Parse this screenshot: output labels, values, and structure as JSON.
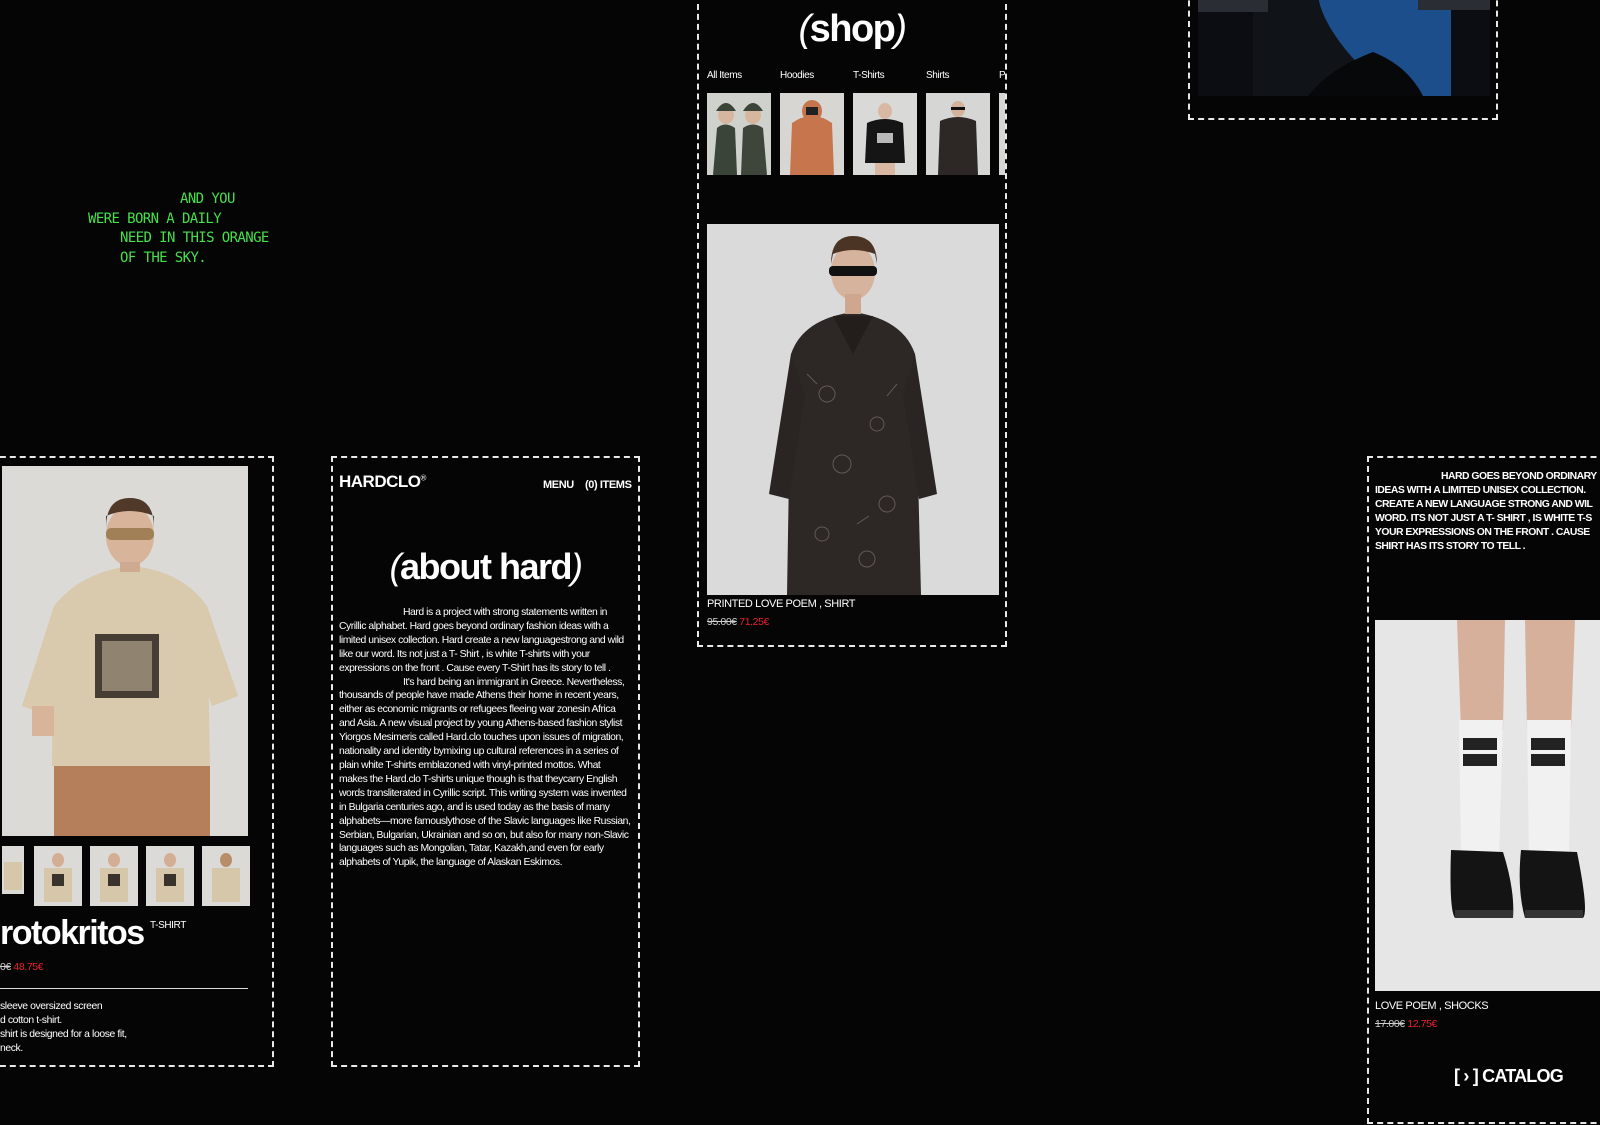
{
  "tagline": {
    "lines": [
      "AND YOU",
      "WERE BORN A DAILY",
      "NEED IN THIS ORANGE",
      "OF THE SKY."
    ]
  },
  "shop": {
    "title": "shop",
    "categories": [
      "All Items",
      "Hoodies",
      "T-Shirts",
      "Shirts",
      "P"
    ],
    "featured": {
      "name": "PRINTED LOVE POEM , SHIRT",
      "old_price": "95.00€",
      "price": "71.25€"
    }
  },
  "product_left": {
    "name": "rotokritos",
    "type": "T-SHIRT",
    "old_price": "0€",
    "price": "48.75€",
    "description": [
      "sleeve oversized screen",
      "d cotton t-shirt.",
      "shirt is designed for a loose fit,",
      "neck."
    ]
  },
  "about": {
    "logo": "HARDCLO",
    "logo_mark": "®",
    "menu_label": "MENU",
    "cart_label": "(0) ITEMS",
    "title": "about hard",
    "paragraph1": "Hard is a project with strong statements written in Cyrillic alphabet. Hard goes beyond ordinary fashion ideas with a limited unisex collection. Hard create a new languagestrong and wild like our word. Its not just a T- Shirt , is white T-shirts with your expressions on the front . Cause every T-Shirt has its story to tell .",
    "paragraph2": "It's hard being an immigrant in Greece. Nevertheless, thousands of people have made Athens their home in recent years, either as economic migrants or refugees fleeing war zonesin Africa and Asia. A new visual project by young Athens-based fashion stylist Yiorgos Mesimeris called Hard.clo touches upon issues of migration, nationality and identity bymixing up cultural references in a series of plain white T-shirts emblazoned with vinyl-printed mottos. What makes the Hard.clo T-shirts unique though is that theycarry English words transliterated in Cyrillic script. This writing system was invented in Bulgaria centuries ago, and is used today as the basis of many alphabets—more famouslythose of the Slavic languages like Russian, Serbian, Bulgarian, Ukrainian and so on, but also for many non-Slavic languages such as Mongolian, Tatar, Kazakh,and even for early alphabets of Yupik, the language of Alaskan Eskimos."
  },
  "right_panel": {
    "statement": [
      "HARD GOES BEYOND ORDINARY",
      "IDEAS WITH A LIMITED UNISEX COLLECTION.",
      "CREATE A NEW LANGUAGE STRONG AND WIL",
      "WORD. ITS NOT JUST A T- SHIRT , IS WHITE T-S",
      "YOUR EXPRESSIONS ON THE FRONT . CAUSE",
      "SHIRT HAS ITS STORY TO TELL ."
    ],
    "product": {
      "name": "LOVE POEM , SHOCKS",
      "old_price": "17.00€",
      "price": "12.75€"
    },
    "catalog_label": "[ › ] CATALOG"
  },
  "colors": {
    "background": "#050505",
    "accent_green": "#46e04a",
    "sale_red": "#e8222a",
    "frame": "#e8e8e8"
  }
}
